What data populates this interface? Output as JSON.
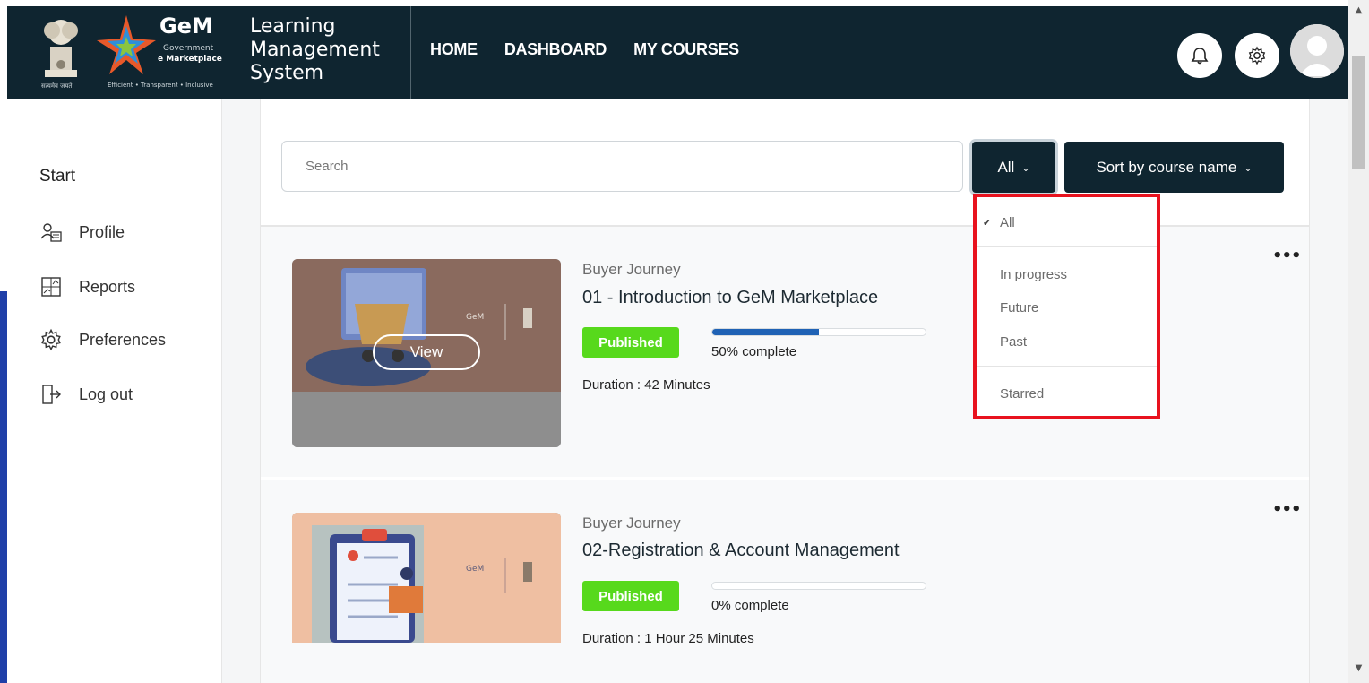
{
  "header": {
    "emblem_caption": "सत्यमेव जयते",
    "gem_word": "GeM",
    "gem_sub1": "Government",
    "gem_sub2": "e Marketplace",
    "gem_tagline": "Efficient • Transparent • Inclusive",
    "lms_line1": "Learning",
    "lms_line2": "Management",
    "lms_line3": "System",
    "nav": [
      "HOME",
      "DASHBOARD",
      "MY COURSES"
    ]
  },
  "sidebar": {
    "heading": "Start",
    "items": [
      {
        "label": "Profile",
        "icon": "profile-icon"
      },
      {
        "label": "Reports",
        "icon": "reports-icon"
      },
      {
        "label": "Preferences",
        "icon": "gear-icon"
      },
      {
        "label": "Log out",
        "icon": "logout-icon"
      }
    ]
  },
  "filters": {
    "search_placeholder": "Search",
    "grouping_label": "All",
    "sort_label": "Sort by course name",
    "menu_items": [
      "All",
      "In progress",
      "Future",
      "Past",
      "Starred"
    ],
    "selected": "All"
  },
  "courses": [
    {
      "category": "Buyer Journey",
      "title": "01 - Introduction to GeM Marketplace",
      "status": "Published",
      "progress": 0.5,
      "progress_text": "50% complete",
      "duration": "Duration : 42 Minutes",
      "view_label": "View"
    },
    {
      "category": "Buyer Journey",
      "title": "02-Registration & Account Management",
      "status": "Published",
      "progress": 0.0,
      "progress_text": "0% complete",
      "duration": "Duration : 1 Hour 25 Minutes"
    }
  ],
  "colors": {
    "header_bg": "#0f2530",
    "badge_green": "#57d91c",
    "progress_blue": "#1f62b5",
    "highlight_red": "#e8121e"
  }
}
